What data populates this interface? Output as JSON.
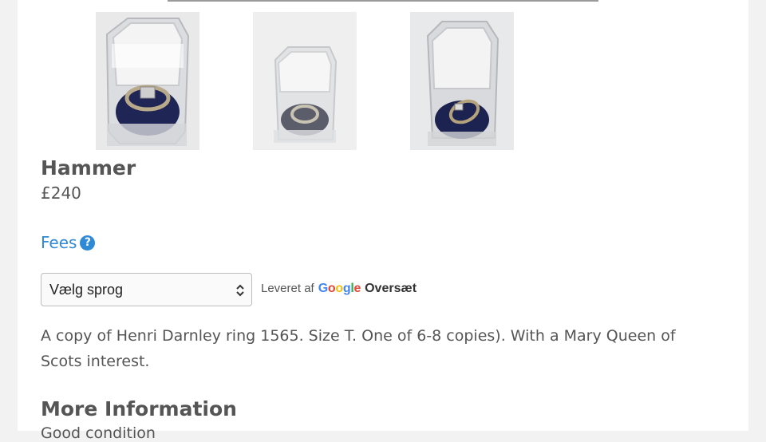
{
  "gallery": {
    "images": [
      {
        "name": "ring-photo-1",
        "description": "clear box with ring on navy cushion"
      },
      {
        "name": "ring-photo-2",
        "description": "clear box with ring, faded"
      },
      {
        "name": "ring-photo-3",
        "description": "clear box with ring lying on cushion"
      }
    ]
  },
  "lot": {
    "title": "Hammer",
    "price": "£240"
  },
  "fees": {
    "label": "Fees",
    "icon": "question-circle-icon",
    "icon_glyph": "?"
  },
  "translate": {
    "selected_language": "Vælg sprog",
    "powered_by": "Leveret af",
    "google_letters": [
      "G",
      "o",
      "o",
      "g",
      "l",
      "e"
    ],
    "google_colors": [
      "#4285F4",
      "#EA4335",
      "#FBBC05",
      "#4285F4",
      "#34A853",
      "#EA4335"
    ],
    "translate_label": "Oversæt"
  },
  "description": "A copy of Henri Darnley ring 1565. Size T. One of 6-8 copies). With a Mary Queen of Scots interest.",
  "more_information": {
    "heading": "More Information",
    "first_line": "Good condition"
  },
  "colors": {
    "link": "#2e89d6",
    "text": "#555555"
  }
}
